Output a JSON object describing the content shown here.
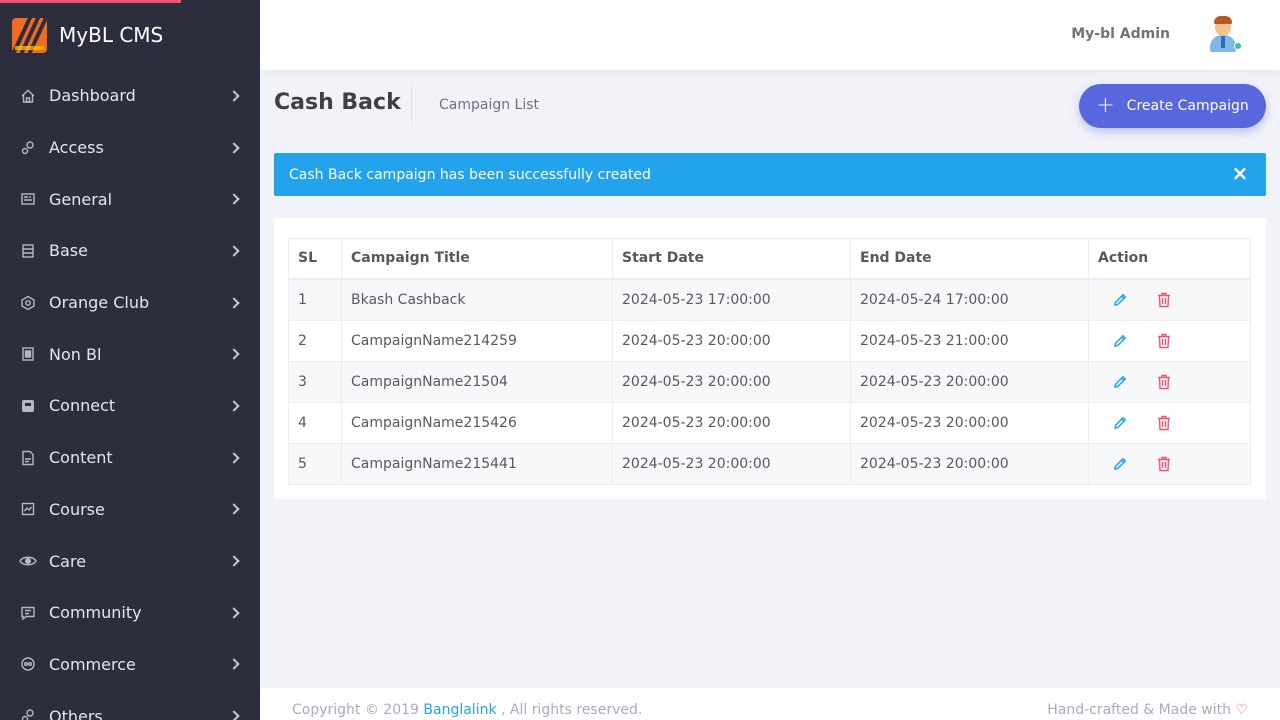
{
  "brand": {
    "name": "MyBL CMS"
  },
  "sidebar": {
    "items": [
      {
        "label": "Dashboard",
        "icon": "home-icon"
      },
      {
        "label": "Access",
        "icon": "gears-icon"
      },
      {
        "label": "General",
        "icon": "newspaper-icon"
      },
      {
        "label": "Base",
        "icon": "list-icon"
      },
      {
        "label": "Orange Club",
        "icon": "badge-icon"
      },
      {
        "label": "Non Bl",
        "icon": "sim-icon"
      },
      {
        "label": "Connect",
        "icon": "connect-icon"
      },
      {
        "label": "Content",
        "icon": "file-icon"
      },
      {
        "label": "Course",
        "icon": "book-icon"
      },
      {
        "label": "Care",
        "icon": "eye-icon"
      },
      {
        "label": "Community",
        "icon": "chat-icon"
      },
      {
        "label": "Commerce",
        "icon": "money-icon"
      },
      {
        "label": "Others",
        "icon": "gears-icon"
      }
    ]
  },
  "header": {
    "user_name": "My-bl Admin"
  },
  "subheader": {
    "title": "Cash Back",
    "breadcrumb": "Campaign List",
    "create_label": "Create Campaign"
  },
  "alert": {
    "message": "Cash Back campaign has been successfully created",
    "close_symbol": "×",
    "color": "#22a3ec"
  },
  "table": {
    "columns": [
      "SL",
      "Campaign Title",
      "Start Date",
      "End Date",
      "Action"
    ],
    "rows": [
      [
        "1",
        "Bkash Cashback",
        "2024-05-23 17:00:00",
        "2024-05-24 17:00:00"
      ],
      [
        "2",
        "CampaignName214259",
        "2024-05-23 20:00:00",
        "2024-05-23 21:00:00"
      ],
      [
        "3",
        "CampaignName21504",
        "2024-05-23 20:00:00",
        "2024-05-23 20:00:00"
      ],
      [
        "4",
        "CampaignName215426",
        "2024-05-23 20:00:00",
        "2024-05-23 20:00:00"
      ],
      [
        "5",
        "CampaignName215441",
        "2024-05-23 20:00:00",
        "2024-05-23 20:00:00"
      ]
    ]
  },
  "footer": {
    "copyright_prefix": "Copyright © 2019",
    "company": "Banglalink",
    "copyright_suffix": ", All rights reserved.",
    "made_with": "Hand-crafted & Made with",
    "heart": "♡"
  },
  "colors": {
    "sidebar": "#2c2e3e",
    "accent": "#5867dd",
    "info": "#22a3ec",
    "danger": "#f4516c"
  }
}
